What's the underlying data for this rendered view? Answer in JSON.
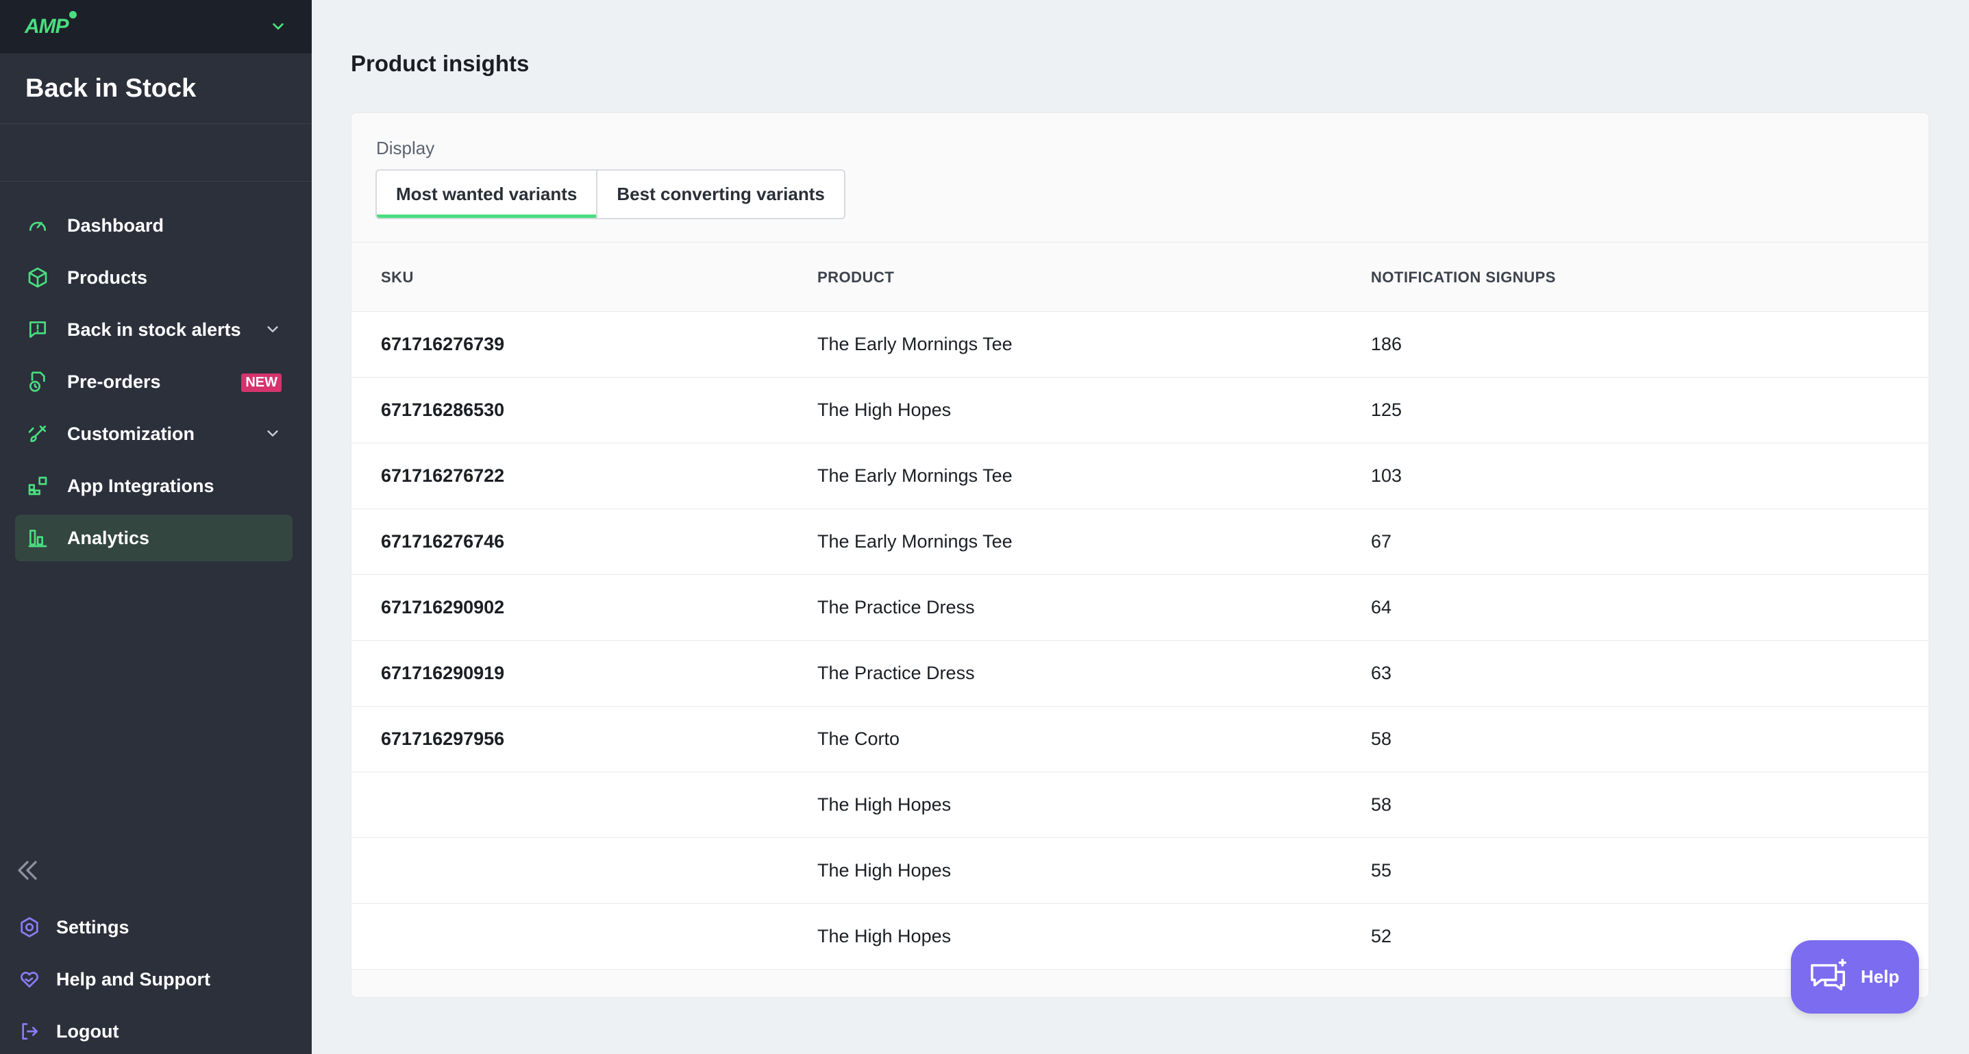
{
  "brand": {
    "logo_text": "AMP",
    "app_title": "Back in Stock"
  },
  "sidebar": {
    "items": [
      {
        "label": "Dashboard",
        "icon": "gauge-icon"
      },
      {
        "label": "Products",
        "icon": "box-icon"
      },
      {
        "label": "Back in stock alerts",
        "icon": "alert-message-icon",
        "expandable": true
      },
      {
        "label": "Pre-orders",
        "icon": "preorder-icon",
        "badge": "NEW"
      },
      {
        "label": "Customization",
        "icon": "brush-icon",
        "expandable": true
      },
      {
        "label": "App Integrations",
        "icon": "integrations-icon"
      },
      {
        "label": "Analytics",
        "icon": "bar-chart-icon",
        "active": true
      }
    ],
    "bottom": [
      {
        "label": "Settings",
        "icon": "gear-icon"
      },
      {
        "label": "Help and Support",
        "icon": "heart-hand-icon"
      },
      {
        "label": "Logout",
        "icon": "logout-icon"
      }
    ]
  },
  "main": {
    "title": "Product insights",
    "display_label": "Display",
    "tabs": [
      {
        "label": "Most wanted variants",
        "active": true
      },
      {
        "label": "Best converting variants",
        "active": false
      }
    ],
    "table": {
      "headers": [
        "SKU",
        "PRODUCT",
        "NOTIFICATION SIGNUPS"
      ],
      "rows": [
        {
          "sku": "671716276739",
          "product": "The Early Mornings Tee",
          "signups": "186"
        },
        {
          "sku": "671716286530",
          "product": "The High Hopes",
          "signups": "125"
        },
        {
          "sku": "671716276722",
          "product": "The Early Mornings Tee",
          "signups": "103"
        },
        {
          "sku": "671716276746",
          "product": "The Early Mornings Tee",
          "signups": "67"
        },
        {
          "sku": "671716290902",
          "product": "The Practice Dress",
          "signups": "64"
        },
        {
          "sku": "671716290919",
          "product": "The Practice Dress",
          "signups": "63"
        },
        {
          "sku": "671716297956",
          "product": "The Corto",
          "signups": "58"
        },
        {
          "sku": "",
          "product": "The High Hopes",
          "signups": "58"
        },
        {
          "sku": "",
          "product": "The High Hopes",
          "signups": "55"
        },
        {
          "sku": "",
          "product": "The High Hopes",
          "signups": "52"
        }
      ]
    }
  },
  "help_button": {
    "label": "Help"
  },
  "colors": {
    "accent": "#4ade80",
    "sidebar_bg": "#2b303b",
    "help_bg": "#7c6cf0",
    "badge": "#d6336c",
    "bottom_icons": "#8b7cf6"
  }
}
